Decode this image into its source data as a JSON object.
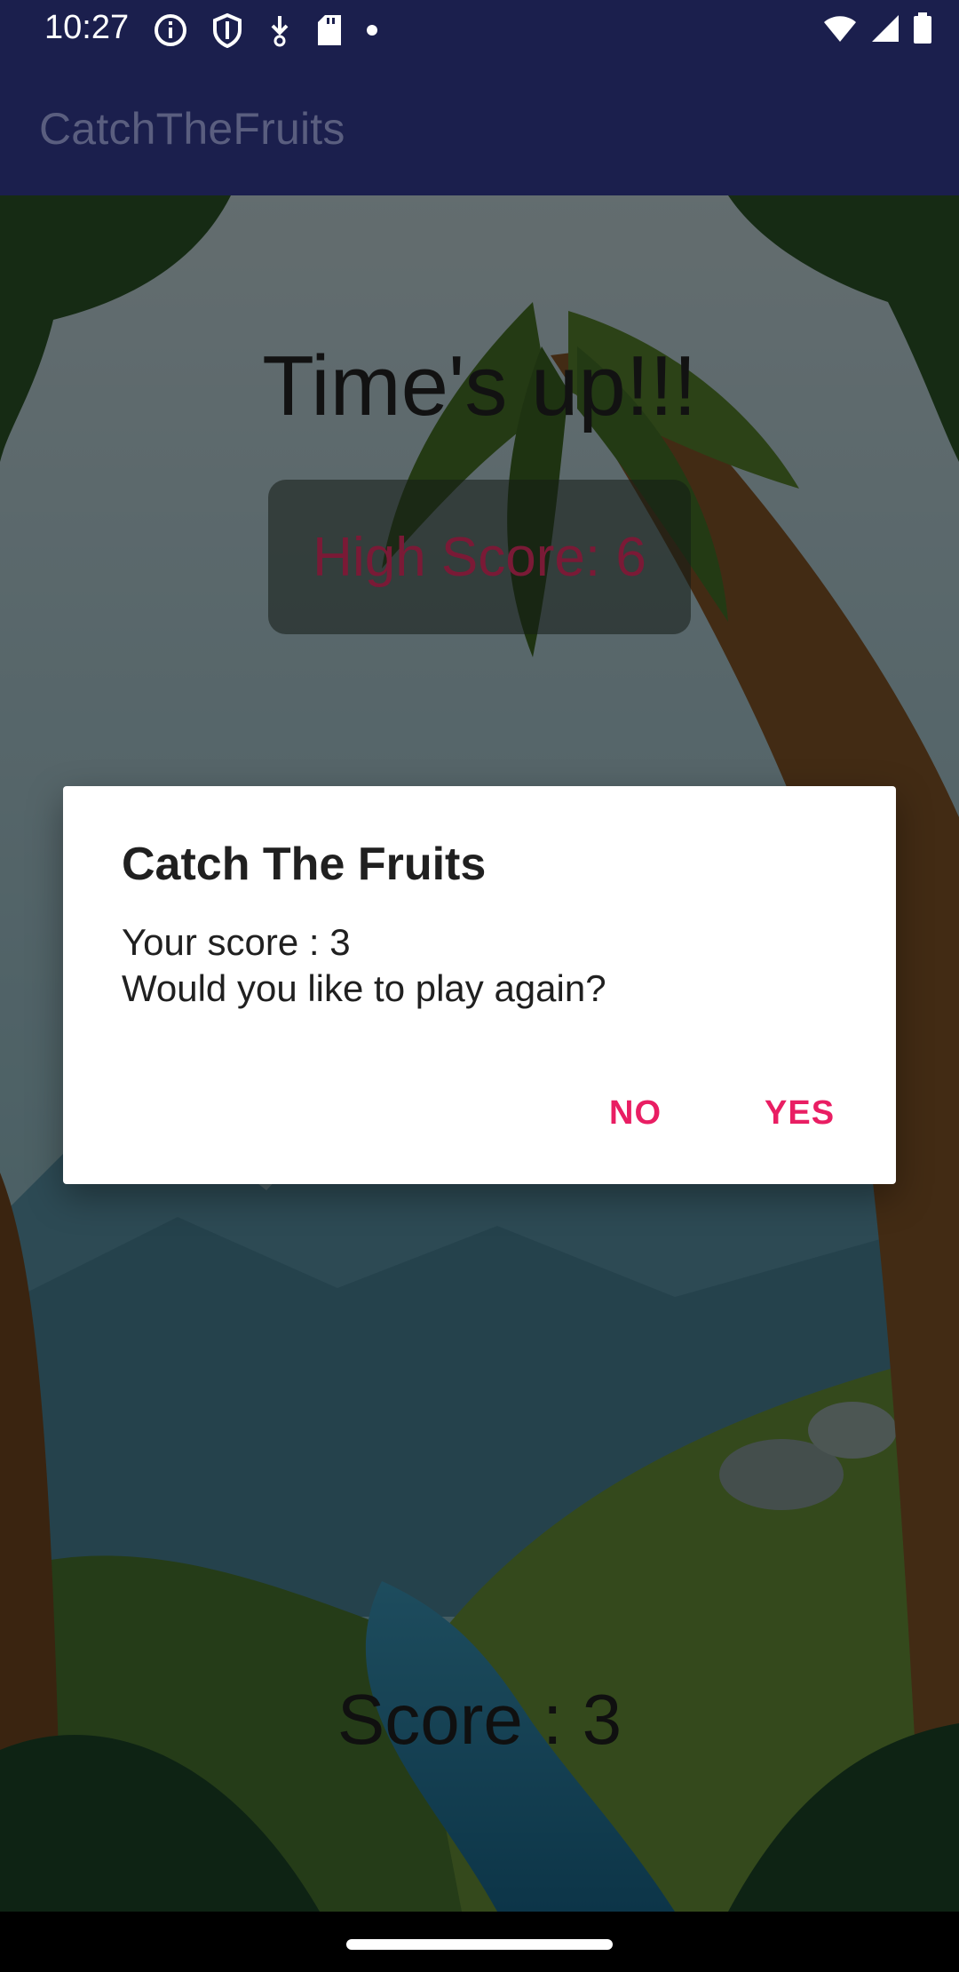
{
  "status_bar": {
    "time": "10:27",
    "icons": [
      "info-icon",
      "shield-icon",
      "download-icon",
      "sd-card-icon",
      "dot-icon"
    ],
    "right_icons": [
      "wifi-icon",
      "signal-icon",
      "battery-icon"
    ]
  },
  "app_bar": {
    "title": "CatchTheFruits"
  },
  "game": {
    "times_up": "Time's up!!!",
    "high_score": "High Score: 6",
    "score": "Score : 3"
  },
  "dialog": {
    "title": "Catch The Fruits",
    "message_line1": "Your score : 3",
    "message_line2": "Would you like to play again?",
    "negative_button": "NO",
    "positive_button": "YES"
  },
  "colors": {
    "app_bar": "#1b1f4d",
    "accent": "#e91e63",
    "high_score_text": "#7a1a36"
  }
}
